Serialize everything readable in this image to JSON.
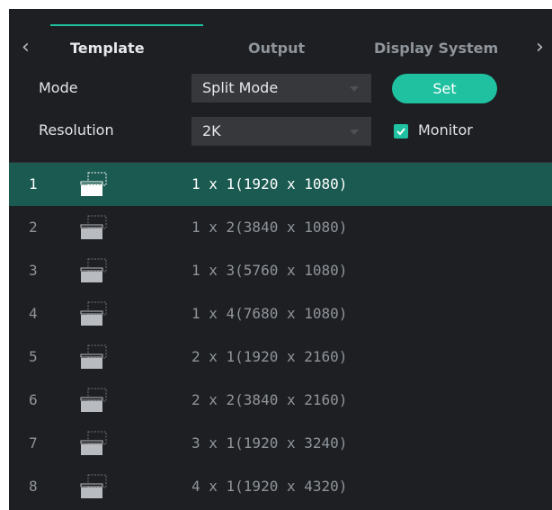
{
  "tabs": {
    "items": [
      "Template",
      "Output",
      "Display System"
    ],
    "active_index": 0
  },
  "form": {
    "mode_label": "Mode",
    "mode_value": "Split Mode",
    "resolution_label": "Resolution",
    "resolution_value": "2K",
    "set_label": "Set",
    "monitor_label": "Monitor",
    "monitor_checked": true
  },
  "templates": {
    "selected_index": 0,
    "rows": [
      {
        "num": "1",
        "desc": "1 x 1(1920 x 1080)"
      },
      {
        "num": "2",
        "desc": "1 x 2(3840 x 1080)"
      },
      {
        "num": "3",
        "desc": "1 x 3(5760 x 1080)"
      },
      {
        "num": "4",
        "desc": "1 x 4(7680 x 1080)"
      },
      {
        "num": "5",
        "desc": "2 x 1(1920 x 2160)"
      },
      {
        "num": "6",
        "desc": "2 x 2(3840 x 2160)"
      },
      {
        "num": "7",
        "desc": "3 x 1(1920 x 3240)"
      },
      {
        "num": "8",
        "desc": "4 x 1(1920 x 4320)"
      }
    ]
  },
  "colors": {
    "accent": "#1fc1a0",
    "panel_bg": "#1e1f22",
    "selected_row_bg": "#1a5a50"
  }
}
